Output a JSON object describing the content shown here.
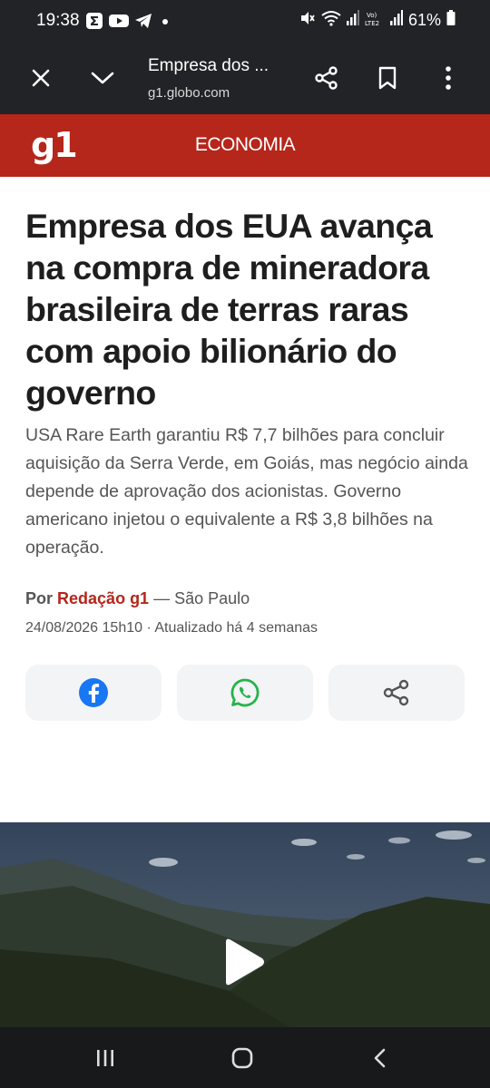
{
  "status_bar": {
    "time": "19:38",
    "battery": "61%",
    "icons": [
      "sigma-app-icon",
      "youtube-icon",
      "telegram-icon",
      "dot-icon",
      "mute-icon",
      "wifi-icon",
      "signal-icon",
      "volte-icon",
      "signal-icon",
      "battery-icon"
    ]
  },
  "browser": {
    "title": "Empresa dos ...",
    "url": "g1.globo.com",
    "buttons": [
      "close-icon",
      "chevron-down-icon",
      "share-icon",
      "bookmark-icon",
      "more-vert-icon"
    ]
  },
  "site": {
    "logo": "g1",
    "section": "ECONOMIA",
    "brand_color": "#b5261b"
  },
  "article": {
    "headline": "Empresa dos EUA avança na compra de mineradora brasileira de terras raras com apoio bilionário do governo",
    "subtitle": "USA Rare Earth garantiu R$ 7,7 bilhões para concluir aquisição da Serra Verde, em Goiás, mas negócio ainda depende de aprovação dos acionistas. Governo americano injetou o equivalente a R$ 3,8 bilhões na operação.",
    "byline_label": "Por",
    "author": "Redação g1",
    "location": " — São Paulo",
    "date": "24/08/2026 15h10 · Atualizado há 4 semanas"
  },
  "share": {
    "buttons": [
      {
        "name": "facebook",
        "icon": "facebook-icon",
        "color": "#1877f2"
      },
      {
        "name": "whatsapp",
        "icon": "whatsapp-icon",
        "color": "#25b34a"
      },
      {
        "name": "share",
        "icon": "share-icon",
        "color": "#555555"
      }
    ]
  },
  "video": {
    "play_icon": "play-icon"
  },
  "nav": {
    "buttons": [
      "recent-apps-icon",
      "home-icon",
      "back-icon"
    ]
  }
}
